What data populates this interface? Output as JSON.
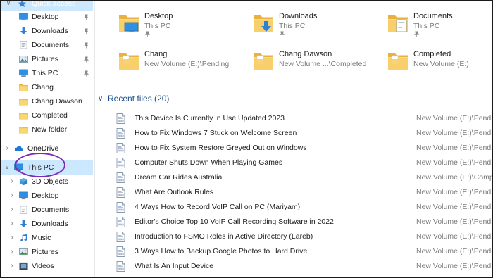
{
  "sidebar": {
    "quick_access": "Quick access",
    "desktop": "Desktop",
    "downloads": "Downloads",
    "documents": "Documents",
    "pictures": "Pictures",
    "this_pc_pinned": "This PC",
    "chang": "Chang",
    "chang_dawson": "Chang Dawson",
    "completed": "Completed",
    "new_folder": "New folder",
    "onedrive": "OneDrive",
    "this_pc": "This PC",
    "objects_3d": "3D Objects",
    "pc_desktop": "Desktop",
    "pc_documents": "Documents",
    "pc_downloads": "Downloads",
    "music": "Music",
    "pc_pictures": "Pictures",
    "videos": "Videos"
  },
  "folders": [
    {
      "name": "Desktop",
      "location": "This PC",
      "pinned": true
    },
    {
      "name": "Downloads",
      "location": "This PC",
      "pinned": true
    },
    {
      "name": "Documents",
      "location": "This PC",
      "pinned": true
    },
    {
      "name": "Chang",
      "location": "New Volume (E:)\\Pending"
    },
    {
      "name": "Chang Dawson",
      "location": "New Volume ...\\Completed"
    },
    {
      "name": "Completed",
      "location": "New Volume (E:)"
    }
  ],
  "recent": {
    "title": "Recent files (20)",
    "files": [
      {
        "name": "This Device Is Currently in Use Updated 2023",
        "location": "New Volume (E:)\\Pending"
      },
      {
        "name": "How to Fix Windows 7 Stuck on Welcome Screen",
        "location": "New Volume (E:)\\Pending"
      },
      {
        "name": "How to Fix System Restore Greyed Out on Windows",
        "location": "New Volume (E:)\\Pending"
      },
      {
        "name": "Computer Shuts Down When Playing Games",
        "location": "New Volume (E:)\\Pending"
      },
      {
        "name": "Dream Car Rides Australia",
        "location": "New Volume (E:)\\Completed"
      },
      {
        "name": "What Are Outlook Rules",
        "location": "New Volume (E:)\\Pending"
      },
      {
        "name": "4 Ways How to Record VoIP Call on PC (Mariyam)",
        "location": "New Volume (E:)\\Pending"
      },
      {
        "name": "Editor's Choice Top 10 VoIP Call Recording Software in 2022",
        "location": "New Volume (E:)\\Pending"
      },
      {
        "name": "Introduction to FSMO Roles in Active Directory (Lareb)",
        "location": "New Volume (E:)\\Pending"
      },
      {
        "name": "3 Ways How to Backup Google Photos to Hard Drive",
        "location": "New Volume (E:)\\Pending"
      },
      {
        "name": "What Is An Input Device",
        "location": "New Volume (E:)\\Pending"
      }
    ]
  },
  "colors": {
    "selection": "#cce8ff",
    "accent": "#1f4e8c",
    "folder": "#f3c55a",
    "annotation": "#7b2bb8"
  }
}
